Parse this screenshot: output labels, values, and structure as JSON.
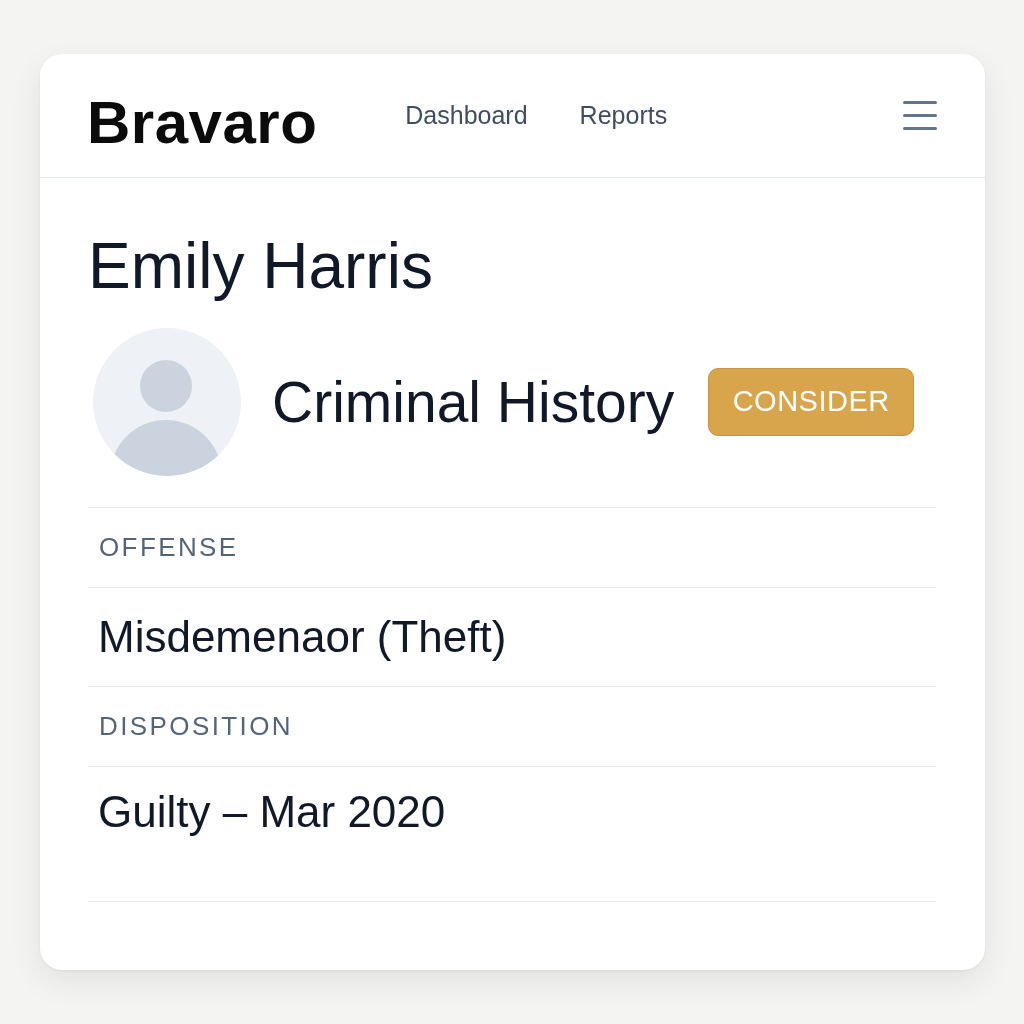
{
  "header": {
    "logo": "Bravaro",
    "nav": [
      "Dashboard",
      "Reports"
    ]
  },
  "profile": {
    "name": "Emily Harris",
    "section_title": "Criminal History",
    "badge": "CONSIDER"
  },
  "fields": [
    {
      "label": "OFFENSE",
      "value": "Misdemenaor (Theft)"
    },
    {
      "label": "DISPOSITION",
      "value": "Guilty – Mar 2020"
    }
  ]
}
